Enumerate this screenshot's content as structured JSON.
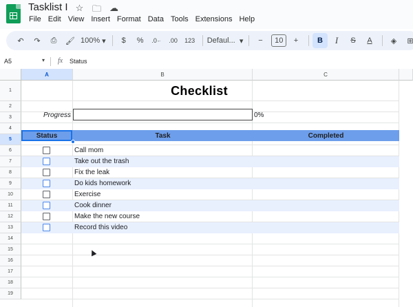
{
  "window": {
    "doc_title": "Tasklist I"
  },
  "menu": [
    "File",
    "Edit",
    "View",
    "Insert",
    "Format",
    "Data",
    "Tools",
    "Extensions",
    "Help"
  ],
  "toolbar": {
    "zoom": "100%",
    "currency": "$",
    "percent": "%",
    "decrease_decimal": ".0←",
    "increase_decimal": ".00",
    "more_formats": "123",
    "font": "Defaul...",
    "font_size": "10",
    "bold": "B",
    "italic": "I",
    "strikethrough": "S",
    "text_color": "A"
  },
  "formula_bar": {
    "name_box": "A5",
    "fx": "fx",
    "content": "Status"
  },
  "columns": [
    "A",
    "B",
    "C"
  ],
  "rows": [
    "1",
    "2",
    "3",
    "4",
    "5",
    "6",
    "7",
    "8",
    "9",
    "10",
    "11",
    "12",
    "13",
    "14",
    "15",
    "16",
    "17",
    "18",
    "19"
  ],
  "sheet": {
    "title": "Checklist",
    "progress_label": "Progress",
    "progress_value": 0,
    "progress_text": "0%",
    "headers": {
      "status": "Status",
      "task": "Task",
      "completed": "Completed"
    },
    "tasks": [
      {
        "task": "Call mom",
        "checked": false
      },
      {
        "task": "Take out the trash",
        "checked": false
      },
      {
        "task": "Fix the leak",
        "checked": false
      },
      {
        "task": "Do kids homework",
        "checked": false
      },
      {
        "task": "Exercise",
        "checked": false
      },
      {
        "task": "Cook dinner",
        "checked": false
      },
      {
        "task": "Make the new course",
        "checked": false
      },
      {
        "task": "Record this video",
        "checked": false
      }
    ]
  },
  "colors": {
    "header_blue": "#6d9eeb",
    "band_blue": "#e8f0fe",
    "selection": "#1a73e8",
    "toolbar_bg": "#edf2fa"
  }
}
